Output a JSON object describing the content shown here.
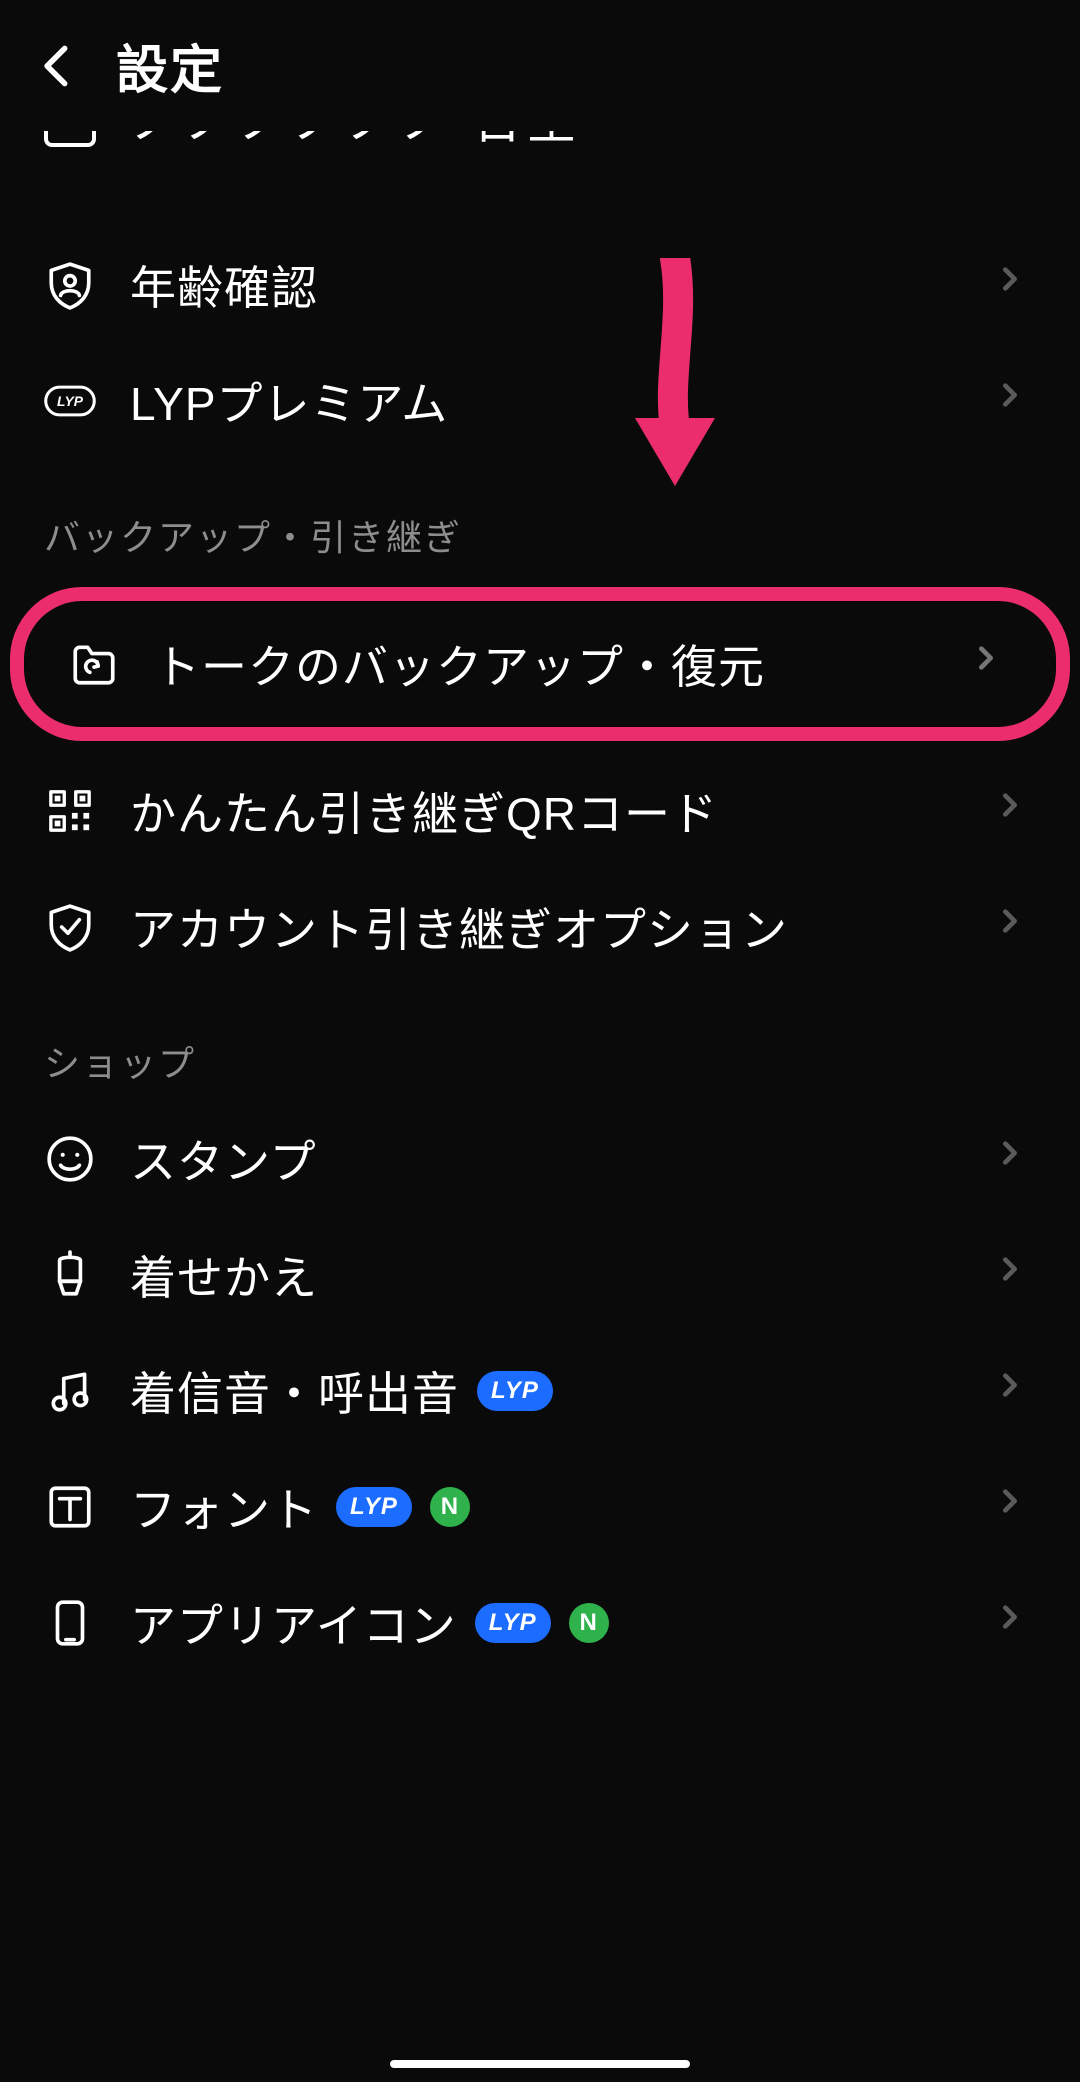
{
  "header": {
    "title": "設定"
  },
  "partial_row": {
    "label": "アカウント管理"
  },
  "rows_top": [
    {
      "id": "age",
      "label": "年齢確認",
      "icon": "shield-user-icon"
    },
    {
      "id": "lyp",
      "label": "LYPプレミアム",
      "icon": "lyp-outline-icon"
    }
  ],
  "section_backup": {
    "title": "バックアップ・引き継ぎ",
    "rows": [
      {
        "id": "backup",
        "label": "トークのバックアップ・復元",
        "icon": "folder-sync-icon",
        "highlight": true
      },
      {
        "id": "qr",
        "label": "かんたん引き継ぎQRコード",
        "icon": "qr-icon"
      },
      {
        "id": "migrate",
        "label": "アカウント引き継ぎオプション",
        "icon": "shield-check-icon"
      }
    ]
  },
  "section_shop": {
    "title": "ショップ",
    "rows": [
      {
        "id": "stamp",
        "label": "スタンプ",
        "icon": "smile-icon",
        "badges": []
      },
      {
        "id": "theme",
        "label": "着せかえ",
        "icon": "brush-icon",
        "badges": []
      },
      {
        "id": "sound",
        "label": "着信音・呼出音",
        "icon": "music-icon",
        "badges": [
          "LYP"
        ]
      },
      {
        "id": "font",
        "label": "フォント",
        "icon": "font-icon",
        "badges": [
          "LYP",
          "N"
        ]
      },
      {
        "id": "appicon",
        "label": "アプリアイコン",
        "icon": "phone-icon",
        "badges": [
          "LYP",
          "N"
        ]
      }
    ]
  },
  "badges": {
    "lyp_text": "LYP",
    "n_text": "N"
  },
  "annotation": {
    "arrow_color": "#ec2d6d"
  }
}
